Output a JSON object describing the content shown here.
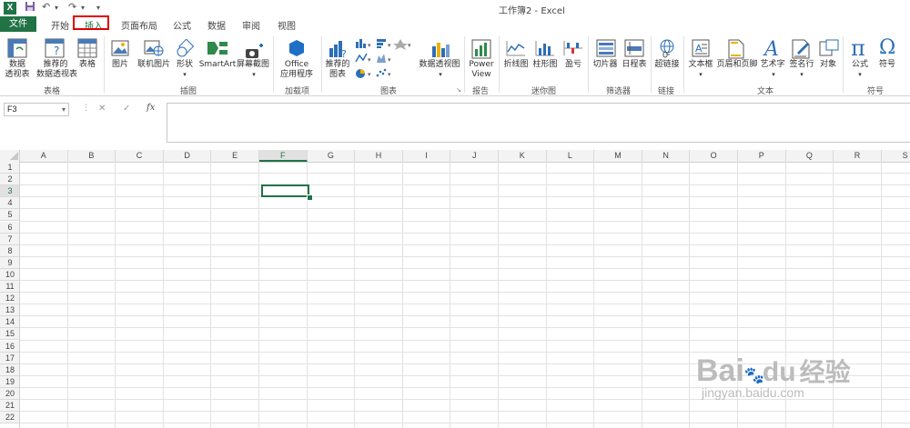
{
  "app": {
    "title": "工作簿2 - Excel",
    "logo": "X"
  },
  "quick_access": {
    "save": "save-icon",
    "undo": "↶",
    "redo": "↷",
    "customize": "▾"
  },
  "tabs": [
    "开始",
    "插入",
    "页面布局",
    "公式",
    "数据",
    "审阅",
    "视图"
  ],
  "file_tab": "文件",
  "active_tab": "插入",
  "ribbon": {
    "pivot_table": "数据\n透视表",
    "recommended_pivot": "推荐的\n数据透视表",
    "table": "表格",
    "picture": "图片",
    "online_picture": "联机图片",
    "shapes": "形状",
    "smartart": "SmartArt",
    "screenshot": "屏幕截图",
    "office_apps": "Office\n应用程序",
    "recommended_charts": "推荐的\n图表",
    "pivot_chart": "数据透视图",
    "power_view": "Power\nView",
    "line_spark": "折线图",
    "column_spark": "柱形图",
    "winloss_spark": "盈亏",
    "slicer": "切片器",
    "timeline": "日程表",
    "hyperlink": "超链接",
    "textbox": "文本框",
    "header_footer": "页眉和页脚",
    "wordart": "艺术字",
    "signature": "签名行",
    "object": "对象",
    "equation": "公式",
    "symbol": "符号",
    "pi_glyph": "π",
    "omega_glyph": "Ω"
  },
  "groups": {
    "tables": "表格",
    "illustrations": "插图",
    "addins": "加载项",
    "charts": "图表",
    "reports": "报告",
    "sparklines": "迷你图",
    "filters": "筛选器",
    "links": "链接",
    "text": "文本",
    "symbols": "符号"
  },
  "formula_bar": {
    "name_box": "F3",
    "cancel": "✕",
    "enter": "✓",
    "fx": "fx",
    "value": ""
  },
  "columns": [
    "A",
    "B",
    "C",
    "D",
    "E",
    "F",
    "G",
    "H",
    "I",
    "J",
    "K",
    "L",
    "M",
    "N",
    "O",
    "P",
    "Q",
    "R",
    "S"
  ],
  "rows": [
    "1",
    "2",
    "3",
    "4",
    "5",
    "6",
    "7",
    "8",
    "9",
    "10",
    "11",
    "12",
    "13",
    "14",
    "15",
    "16",
    "17",
    "18",
    "19",
    "20",
    "21",
    "22"
  ],
  "selected_cell": "F3",
  "watermark": {
    "brand": "Bai",
    "brand2": "du",
    "cn": "经验",
    "url": "jingyan.baidu.com"
  },
  "colors": {
    "excel_green": "#217346",
    "highlight_red": "#e00000"
  }
}
